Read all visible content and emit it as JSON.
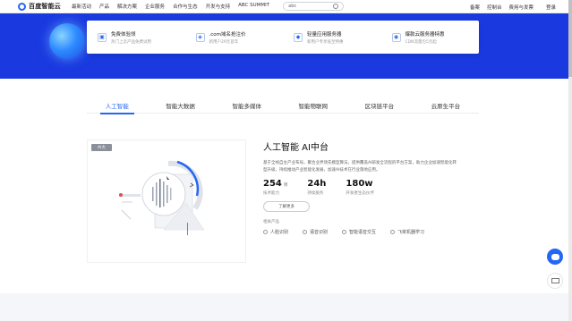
{
  "nav": {
    "logo_text": "百度智能云",
    "links": [
      "最新活动",
      "产品",
      "解决方案",
      "企业服务",
      "合作与生态",
      "开发与支持",
      "ABC SUMMIT"
    ],
    "search_value": "abc",
    "right_links": [
      "备案",
      "控制台",
      "费用与发票",
      "登录"
    ]
  },
  "features": [
    {
      "icon": "gift-icon",
      "title": "免费体验领",
      "sub": "热门上云产品免费试用"
    },
    {
      "icon": "globe-icon",
      "title": ".com域名抢注价",
      "sub": "新用户29元首年"
    },
    {
      "icon": "server-icon",
      "title": "轻量应用服务器",
      "sub": "新用户专享低至特惠"
    },
    {
      "icon": "cloud-icon",
      "title": "爆款云服务器特惠",
      "sub": "CDN流量包5元起"
    }
  ],
  "tabs": [
    "人工智能",
    "智能大数据",
    "智能多媒体",
    "智能物联网",
    "区块链平台",
    "云原生平台"
  ],
  "active_tab": 0,
  "badge": "AI大",
  "content": {
    "title": "人工智能 AI中台",
    "desc": "基于全栈自主产业布局，聚合业界领先模型算法，提供覆盖AI研发全流程的平台方案，助力企业加速智能化转型升级，持续推动产业智能化发展，加速AI技术在行业落地应用。",
    "stats": [
      {
        "value": "254",
        "unit": "项",
        "label": "技术能力"
      },
      {
        "value": "24h",
        "unit": "",
        "label": "持续服务"
      },
      {
        "value": "180w",
        "unit": "",
        "label": "开发者生态伙伴"
      }
    ],
    "more_label": "了解更多",
    "products_label": "相关产品",
    "products": [
      "人脸识别",
      "语音识别",
      "智能语音交互",
      "飞桨机器学习"
    ]
  },
  "colors": {
    "brand": "#2468f2",
    "banner": "#1a3ae0"
  }
}
